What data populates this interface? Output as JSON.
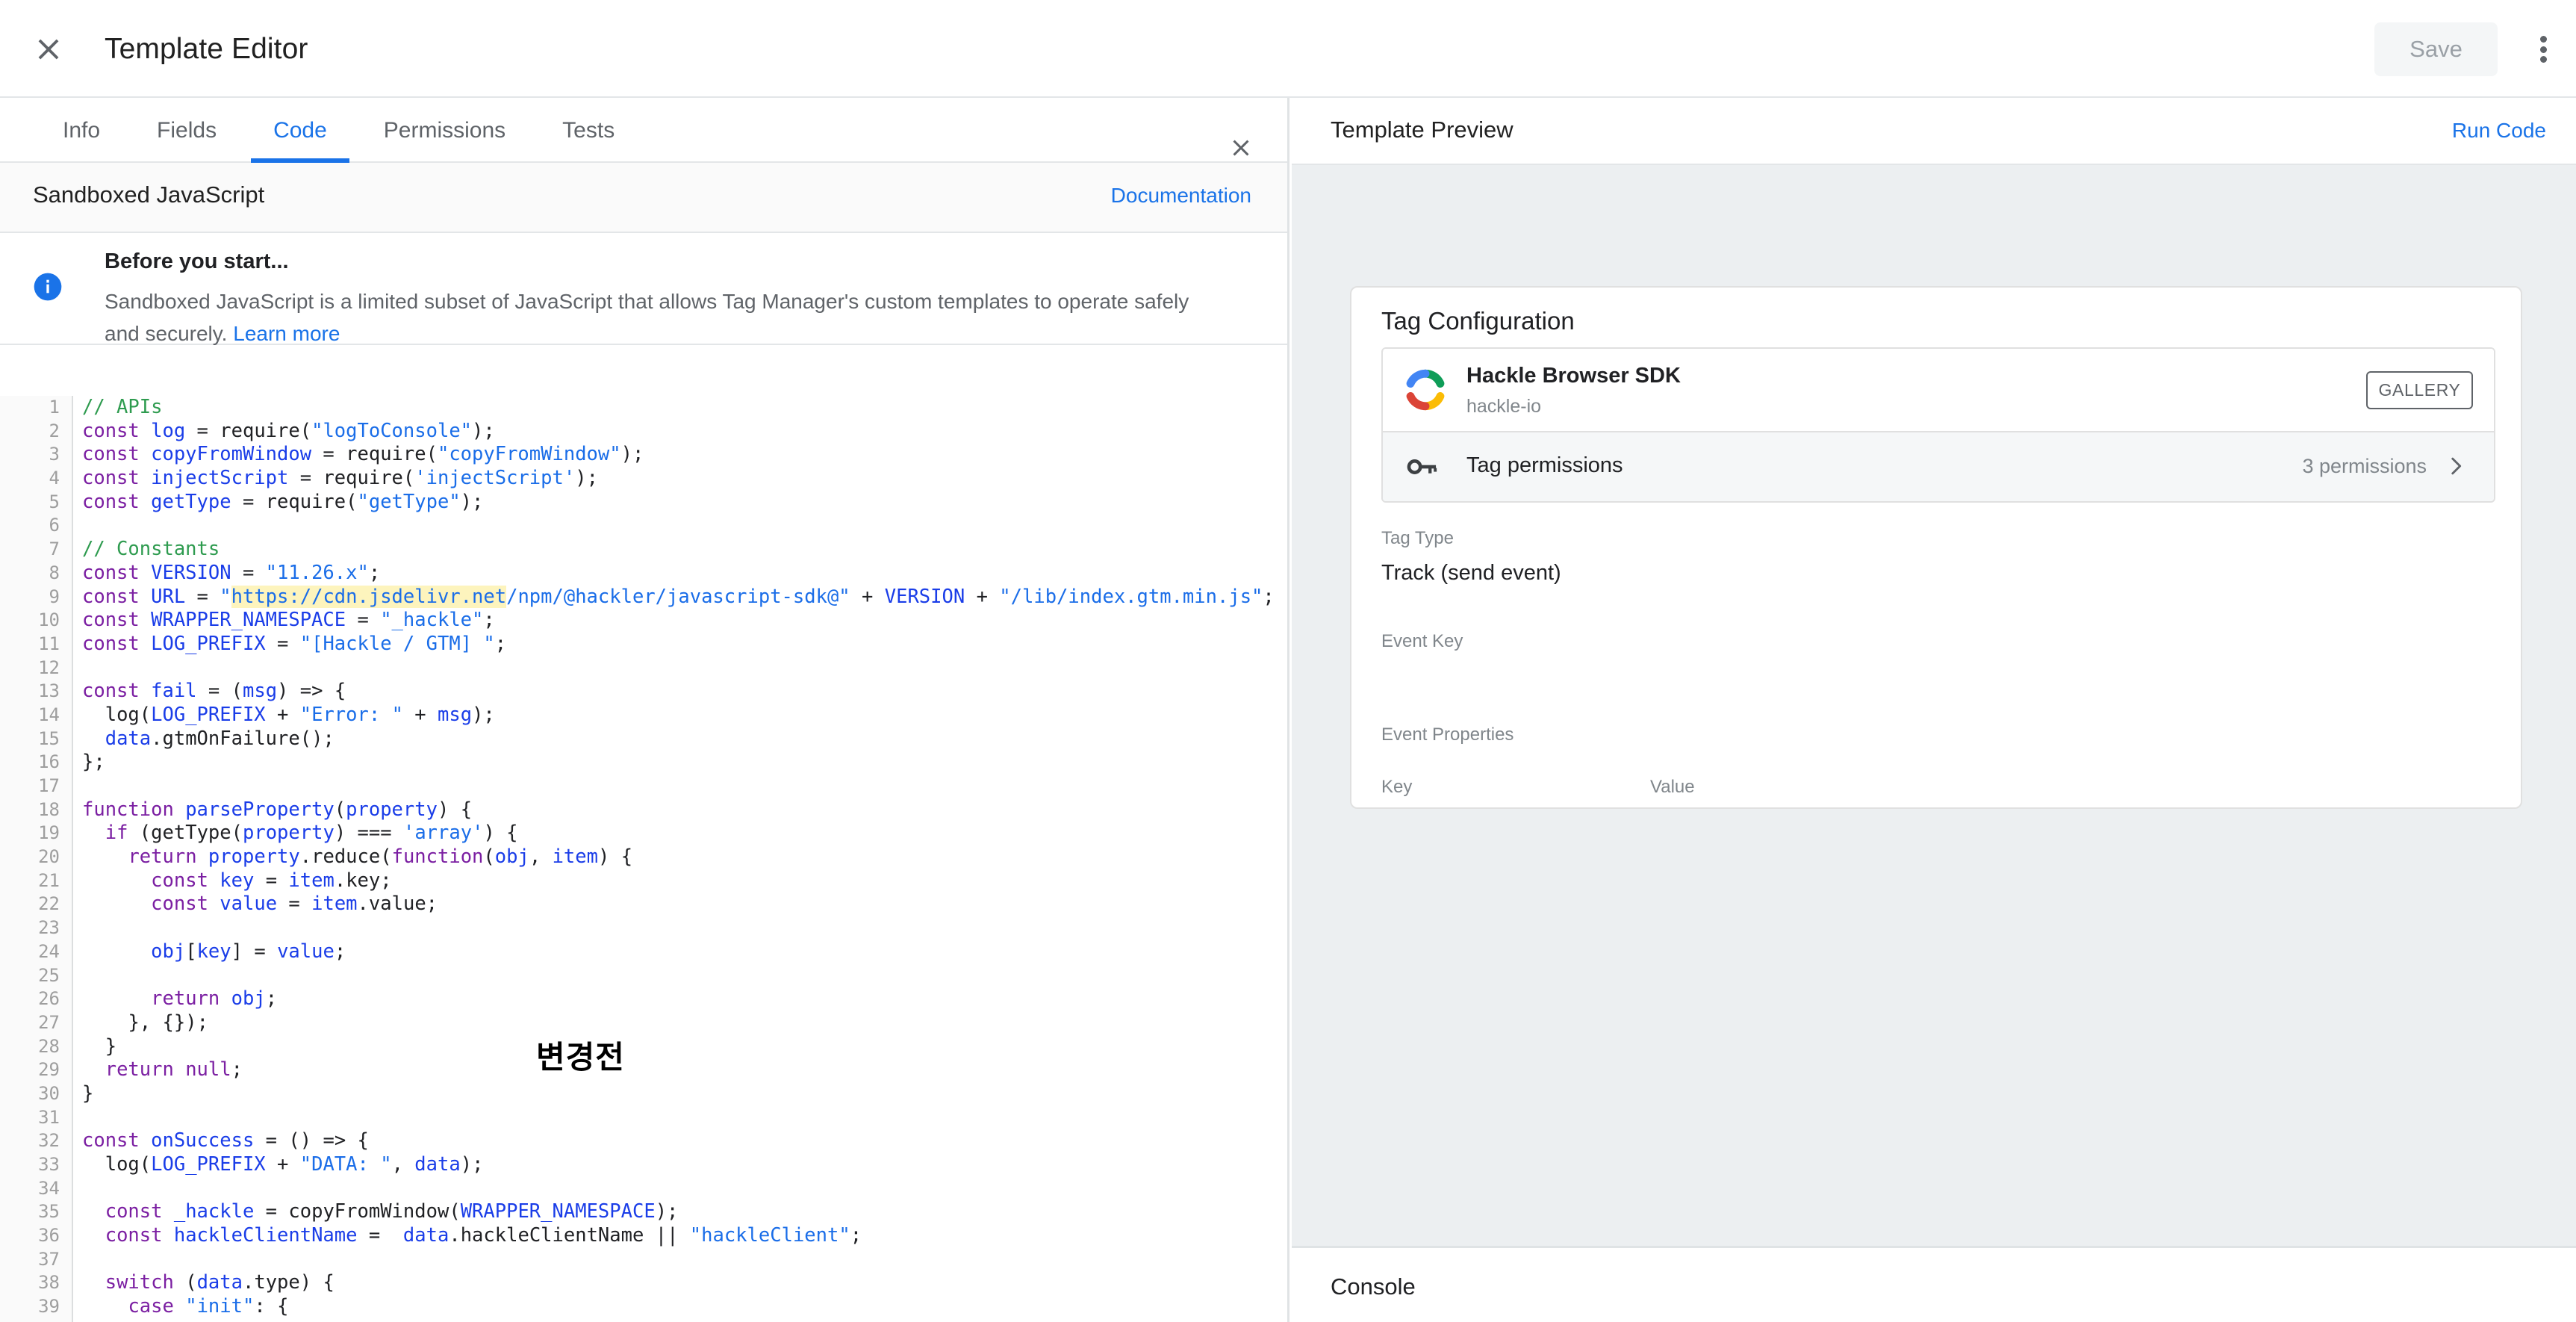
{
  "header": {
    "title": "Template Editor",
    "close_icon": "close-icon",
    "save_label": "Save",
    "overflow_icon": "more-vert-icon"
  },
  "tabs": [
    {
      "label": "Info",
      "active": false
    },
    {
      "label": "Fields",
      "active": false
    },
    {
      "label": "Code",
      "active": true
    },
    {
      "label": "Permissions",
      "active": false
    },
    {
      "label": "Tests",
      "active": false
    }
  ],
  "editor": {
    "section_title": "Sandboxed JavaScript",
    "documentation_label": "Documentation",
    "banner": {
      "icon": "info-circle-icon",
      "title": "Before you start...",
      "body": "Sandboxed JavaScript is a limited subset of JavaScript that allows Tag Manager's custom templates to operate safely and securely.",
      "link_label": "Learn more",
      "close_icon": "close-icon"
    },
    "annotation": "변경전",
    "highlight_color": "#fdf4bd",
    "code_lines": [
      {
        "n": 1,
        "t": "// APIs",
        "cls": "cmt"
      },
      {
        "n": 2,
        "t": "const log = require(\"logToConsole\");"
      },
      {
        "n": 3,
        "t": "const copyFromWindow = require(\"copyFromWindow\");"
      },
      {
        "n": 4,
        "t": "const injectScript = require('injectScript');"
      },
      {
        "n": 5,
        "t": "const getType = require(\"getType\");"
      },
      {
        "n": 6,
        "t": ""
      },
      {
        "n": 7,
        "t": "// Constants",
        "cls": "cmt"
      },
      {
        "n": 8,
        "t": "const VERSION = \"11.26.x\";"
      },
      {
        "n": 9,
        "t": "const URL = \"https://cdn.jsdelivr.net/npm/@hackler/javascript-sdk@\" + VERSION + \"/lib/index.gtm.min.js\";"
      },
      {
        "n": 10,
        "t": "const WRAPPER_NAMESPACE = \"_hackle\";"
      },
      {
        "n": 11,
        "t": "const LOG_PREFIX = \"[Hackle / GTM] \";"
      },
      {
        "n": 12,
        "t": ""
      },
      {
        "n": 13,
        "t": "const fail = (msg) => {"
      },
      {
        "n": 14,
        "t": "  log(LOG_PREFIX + \"Error: \" + msg);"
      },
      {
        "n": 15,
        "t": "  data.gtmOnFailure();"
      },
      {
        "n": 16,
        "t": "};"
      },
      {
        "n": 17,
        "t": ""
      },
      {
        "n": 18,
        "t": "function parseProperty(property) {"
      },
      {
        "n": 19,
        "t": "  if (getType(property) === 'array') {"
      },
      {
        "n": 20,
        "t": "    return property.reduce(function(obj, item) {"
      },
      {
        "n": 21,
        "t": "      const key = item.key;"
      },
      {
        "n": 22,
        "t": "      const value = item.value;"
      },
      {
        "n": 23,
        "t": ""
      },
      {
        "n": 24,
        "t": "      obj[key] = value;"
      },
      {
        "n": 25,
        "t": ""
      },
      {
        "n": 26,
        "t": "      return obj;"
      },
      {
        "n": 27,
        "t": "    }, {});"
      },
      {
        "n": 28,
        "t": "  }"
      },
      {
        "n": 29,
        "t": "  return null;"
      },
      {
        "n": 30,
        "t": "}"
      },
      {
        "n": 31,
        "t": ""
      },
      {
        "n": 32,
        "t": "const onSuccess = () => {"
      },
      {
        "n": 33,
        "t": "  log(LOG_PREFIX + \"DATA: \", data);"
      },
      {
        "n": 34,
        "t": ""
      },
      {
        "n": 35,
        "t": "  const _hackle = copyFromWindow(WRAPPER_NAMESPACE);"
      },
      {
        "n": 36,
        "t": "  const hackleClientName =  data.hackleClientName || \"hackleClient\";"
      },
      {
        "n": 37,
        "t": ""
      },
      {
        "n": 38,
        "t": "  switch (data.type) {"
      },
      {
        "n": 39,
        "t": "    case \"init\": {"
      }
    ]
  },
  "preview": {
    "header_title": "Template Preview",
    "run_code_label": "Run Code",
    "card_title": "Tag Configuration",
    "tag_type_label": "Tag Type",
    "tag_type_selector": {
      "logo_icon": "hackle-logo-icon",
      "name": "Hackle Browser SDK",
      "subtitle": "hackle-io",
      "gallery_badge": "GALLERY"
    },
    "tag_permissions": {
      "icon": "key-icon",
      "label": "Tag permissions",
      "count": "3 permissions",
      "chevron_icon": "chevron-right-icon"
    },
    "tag_type_label2": "Tag Type",
    "tag_type_value": "Track (send event)",
    "event_key_label": "Event Key",
    "event_key_value": "",
    "event_properties_label": "Event Properties",
    "table": {
      "columns": [
        "Key",
        "Value"
      ],
      "rows": []
    }
  },
  "console": {
    "title": "Console"
  },
  "colors": {
    "accent_blue": "#1a73e8",
    "panel_bg": "#eceff1",
    "header_bg": "#ffffff",
    "muted_text": "#80868b",
    "highlight_yellow": "#fdf4bd"
  }
}
